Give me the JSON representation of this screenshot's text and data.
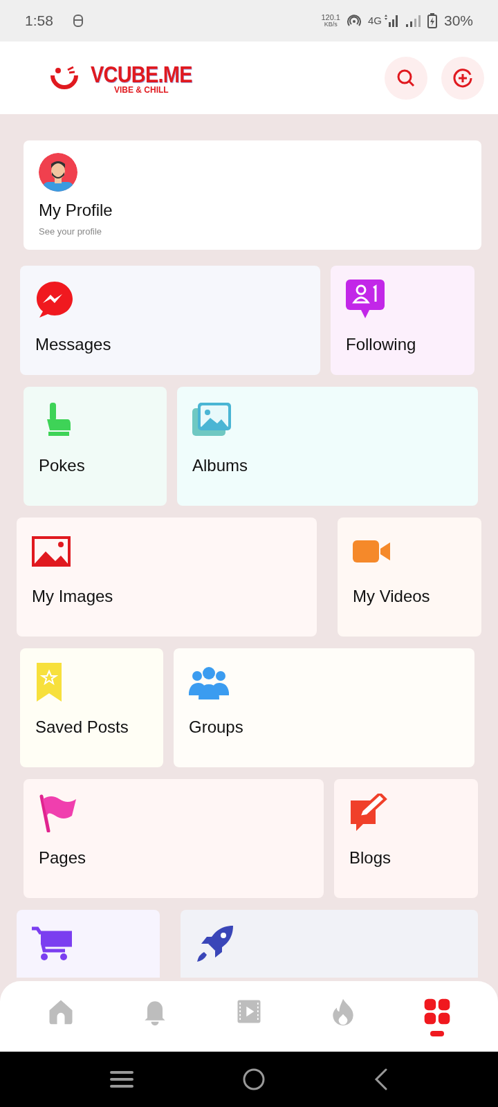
{
  "status_bar": {
    "time": "1:58",
    "speed": "120.1",
    "speed_unit": "KB/s",
    "network": "4G",
    "battery": "30%"
  },
  "header": {
    "logo": "VCUBE.ME",
    "tagline": "VIBE & CHILL"
  },
  "profile": {
    "title": "My Profile",
    "subtitle": "See your profile"
  },
  "rows": [
    [
      {
        "label": "Messages",
        "kind": "messages",
        "color": "#f6f7fc"
      },
      {
        "label": "Following",
        "kind": "following",
        "color": "#fcf0fc"
      }
    ],
    [
      {
        "label": "Pokes",
        "kind": "pokes",
        "color": "#f1fbf7"
      },
      {
        "label": "Albums",
        "kind": "albums",
        "color": "#f0fdfc"
      }
    ],
    [
      {
        "label": "My Images",
        "kind": "images",
        "color": "#fff7f6"
      },
      {
        "label": "My Videos",
        "kind": "videos",
        "color": "#fff8f4"
      }
    ],
    [
      {
        "label": "Saved Posts",
        "kind": "saved",
        "color": "#fffef5"
      },
      {
        "label": "Groups",
        "kind": "groups",
        "color": "#fffdf9"
      }
    ],
    [
      {
        "label": "Pages",
        "kind": "pages",
        "color": "#fff6f5"
      },
      {
        "label": "Blogs",
        "kind": "blogs",
        "color": "#fff5f4"
      }
    ],
    [
      {
        "kind": "market",
        "color": "#f7f4fe"
      },
      {
        "kind": "promoted",
        "color": "#f1f2f7"
      }
    ]
  ],
  "nav": [
    {
      "kind": "home",
      "selected": false
    },
    {
      "kind": "bell",
      "selected": false
    },
    {
      "kind": "video",
      "selected": false
    },
    {
      "kind": "fire",
      "selected": false
    },
    {
      "kind": "grid",
      "selected": true
    }
  ]
}
